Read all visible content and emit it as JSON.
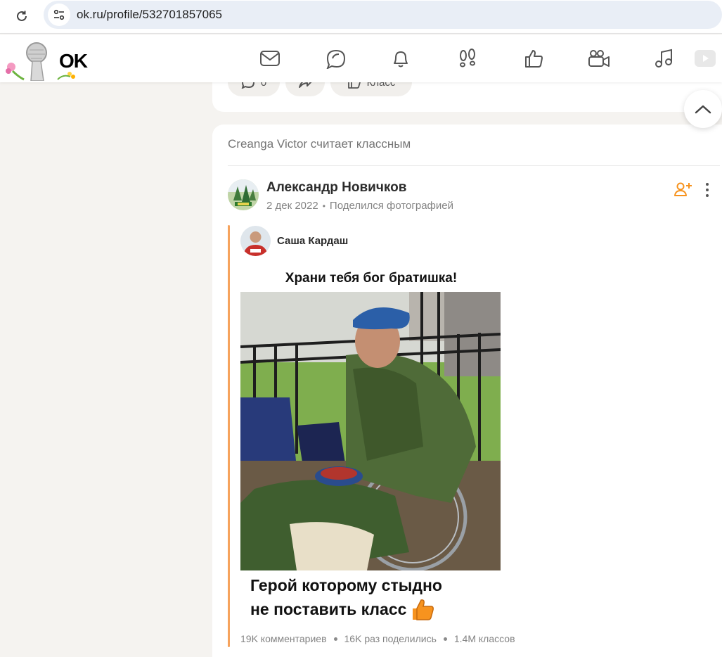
{
  "browser": {
    "url": "ok.ru/profile/532701857065"
  },
  "header": {
    "logo_text": "OK",
    "nav": [
      "envelope-icon",
      "chat-bubbles-icon",
      "bell-icon",
      "footprints-icon",
      "thumbs-up-icon",
      "video-camera-icon",
      "music-note-icon",
      "video-play-icon"
    ]
  },
  "previous_post": {
    "comment_count": "0",
    "class_label": "Класс"
  },
  "post": {
    "liked_by": "Creanga Victor считает классным",
    "author": "Александр Новичков",
    "date": "2 дек 2022",
    "action": "Поделился фотографией",
    "repost_author": "Саша Кардаш",
    "meme_top": "Храни тебя бог братишка!",
    "meme_bottom_line1": "Герой которому стыдно",
    "meme_bottom_line2": "не поставить класс",
    "stats": {
      "comments": "19K комментариев",
      "shares": "16K раз поделились",
      "likes": "1.4M классов"
    }
  },
  "colors": {
    "accent": "#f7931e",
    "repost_line": "#f6a35d"
  }
}
